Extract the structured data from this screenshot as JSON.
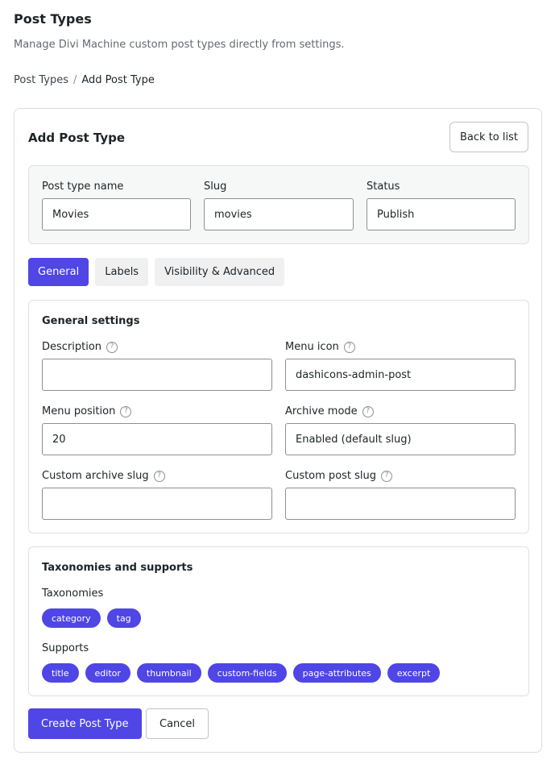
{
  "header": {
    "title": "Post Types",
    "subtitle": "Manage Divi Machine custom post types directly from settings."
  },
  "breadcrumb": {
    "parent": "Post Types",
    "separator": "/",
    "current": "Add Post Type"
  },
  "card": {
    "title": "Add Post Type",
    "back_label": "Back to list"
  },
  "top_fields": {
    "name": {
      "label": "Post type name",
      "value": "Movies"
    },
    "slug": {
      "label": "Slug",
      "value": "movies"
    },
    "status": {
      "label": "Status",
      "value": "Publish"
    }
  },
  "tabs": [
    {
      "label": "General",
      "active": true
    },
    {
      "label": "Labels",
      "active": false
    },
    {
      "label": "Visibility & Advanced",
      "active": false
    }
  ],
  "general": {
    "title": "General settings",
    "description": {
      "label": "Description",
      "value": ""
    },
    "menu_icon": {
      "label": "Menu icon",
      "value": "dashicons-admin-post"
    },
    "menu_position": {
      "label": "Menu position",
      "value": "20"
    },
    "archive_mode": {
      "label": "Archive mode",
      "value": "Enabled (default slug)"
    },
    "custom_archive_slug": {
      "label": "Custom archive slug",
      "value": ""
    },
    "custom_post_slug": {
      "label": "Custom post slug",
      "value": ""
    },
    "help_glyph": "?"
  },
  "taxonomies_section": {
    "title": "Taxonomies and supports",
    "taxonomies_label": "Taxonomies",
    "taxonomies": [
      "category",
      "tag"
    ],
    "supports_label": "Supports",
    "supports": [
      "title",
      "editor",
      "thumbnail",
      "custom-fields",
      "page-attributes",
      "excerpt"
    ]
  },
  "actions": {
    "create_label": "Create Post Type",
    "cancel_label": "Cancel"
  },
  "colors": {
    "accent": "#4f46e5",
    "border": "#dcdcde",
    "muted_text": "#646970"
  }
}
